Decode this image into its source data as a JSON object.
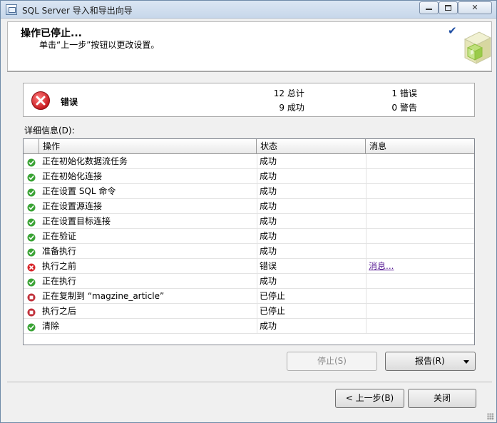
{
  "window": {
    "title": "SQL Server 导入和导出向导"
  },
  "header": {
    "title": "操作已停止...",
    "subtitle": "单击“上一步”按钮以更改设置。"
  },
  "summary": {
    "status": "错误",
    "total": {
      "value": "12",
      "label": "总计"
    },
    "success": {
      "value": "9",
      "label": "成功"
    },
    "error": {
      "value": "1",
      "label": "错误"
    },
    "warning": {
      "value": "0",
      "label": "警告"
    }
  },
  "details": {
    "label": "详细信息(D):",
    "columns": [
      "操作",
      "状态",
      "消息"
    ],
    "rows": [
      {
        "icon": "success",
        "action": "正在初始化数据流任务",
        "status": "成功",
        "message": ""
      },
      {
        "icon": "success",
        "action": "正在初始化连接",
        "status": "成功",
        "message": ""
      },
      {
        "icon": "success",
        "action": "正在设置 SQL 命令",
        "status": "成功",
        "message": ""
      },
      {
        "icon": "success",
        "action": "正在设置源连接",
        "status": "成功",
        "message": ""
      },
      {
        "icon": "success",
        "action": "正在设置目标连接",
        "status": "成功",
        "message": ""
      },
      {
        "icon": "success",
        "action": "正在验证",
        "status": "成功",
        "message": ""
      },
      {
        "icon": "success",
        "action": "准备执行",
        "status": "成功",
        "message": ""
      },
      {
        "icon": "error",
        "action": "执行之前",
        "status": "错误",
        "message": "消息..."
      },
      {
        "icon": "success",
        "action": "正在执行",
        "status": "成功",
        "message": ""
      },
      {
        "icon": "stopped",
        "action": "正在复制到 “magzine_article”",
        "status": "已停止",
        "message": ""
      },
      {
        "icon": "stopped",
        "action": "执行之后",
        "status": "已停止",
        "message": ""
      },
      {
        "icon": "success",
        "action": "清除",
        "status": "成功",
        "message": ""
      }
    ]
  },
  "buttons": {
    "stop": "停止(S)",
    "report": "报告(R)",
    "back": "< 上一步(B)",
    "close": "关闭"
  },
  "colors": {
    "success": "#3aa335",
    "error": "#d8262b",
    "stopped": "#c0303a",
    "link": "#5a1e96"
  }
}
